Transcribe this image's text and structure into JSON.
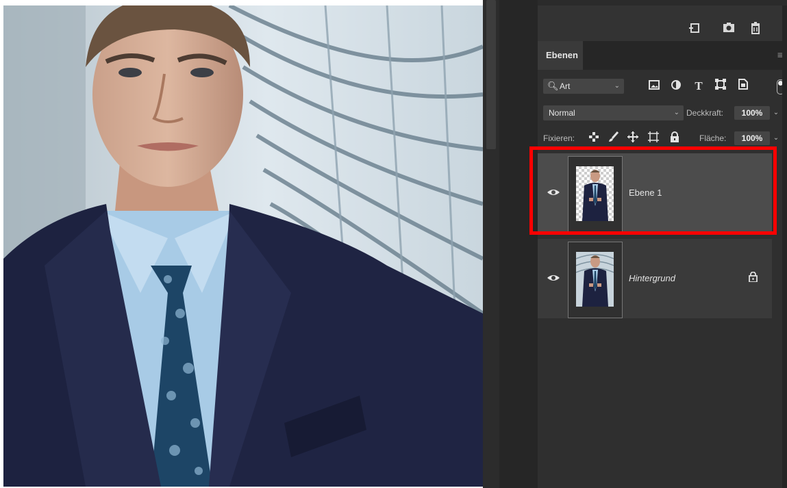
{
  "canvas": {
    "image": "man-in-suit-photo"
  },
  "toolbar": {
    "icons": [
      "new-layer-icon",
      "camera-icon",
      "trash-icon"
    ]
  },
  "panel": {
    "tab_label": "Ebenen",
    "menu_icon": "panel-menu-icon"
  },
  "filter": {
    "kind_label": "Art",
    "icons": [
      "image-filter-icon",
      "adjustment-filter-icon",
      "type-filter-icon",
      "shape-filter-icon",
      "smart-object-filter-icon"
    ]
  },
  "blend": {
    "mode": "Normal",
    "opacity_label": "Deckkraft:",
    "opacity_value": "100%"
  },
  "lock": {
    "label": "Fixieren:",
    "fill_label": "Fläche:",
    "fill_value": "100%"
  },
  "layers": [
    {
      "name": "Ebene 1",
      "selected": true,
      "locked": false,
      "transparent": true
    },
    {
      "name": "Hintergrund",
      "selected": false,
      "locked": true,
      "transparent": false
    }
  ],
  "colors": {
    "panel_bg": "#2f2f2f",
    "selected_layer": "#4c4c4c",
    "highlight": "#ff0000"
  }
}
